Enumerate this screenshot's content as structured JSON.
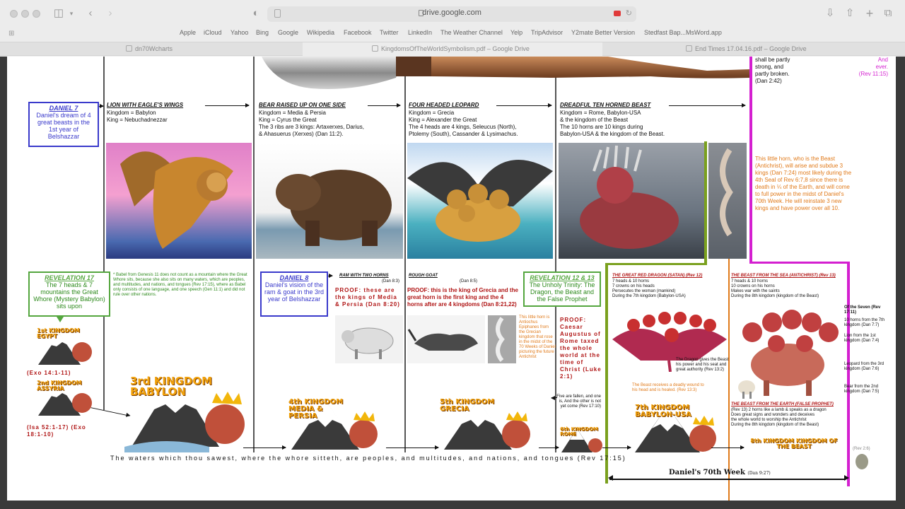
{
  "browser": {
    "url": "drive.google.com",
    "favorites": [
      "Apple",
      "iCloud",
      "Yahoo",
      "Bing",
      "Google",
      "Wikipedia",
      "Facebook",
      "Twitter",
      "LinkedIn",
      "The Weather Channel",
      "Yelp",
      "TripAdvisor",
      "Y2mate Better Version",
      "Stedfast Bap...MsWord.app"
    ],
    "tabs": [
      "dn70Wcharts",
      "KingdomsOfTheWorldSymbolism.pdf – Google Drive",
      "End Times 17.04.16.pdf – Google Drive"
    ]
  },
  "doc": {
    "daniel7": {
      "title": "DANIEL 7",
      "text": "Daniel's dream of 4 great beasts in the 1st year of Belshazzar"
    },
    "columns": [
      {
        "heading": "LION WITH EAGLE'S WINGS",
        "lines": [
          "Kingdom = Babylon",
          "King = Nebuchadnezzar"
        ]
      },
      {
        "heading": "BEAR RAISED UP ON ONE SIDE",
        "lines": [
          "Kingdom = Media & Persia",
          "King = Cyrus the Great",
          "The 3 ribs are 3 kings: Artaxerxes, Darius,",
          "& Ahasuerus (Xerxes) (Dan 11:2)."
        ]
      },
      {
        "heading": "FOUR HEADED LEOPARD",
        "lines": [
          "Kingdom = Grecia",
          "King = Alexander the Great",
          "The 4 heads are 4 kings, Seleucus (North),",
          "Ptolemy (South), Cassander & Lysimachus."
        ]
      },
      {
        "heading": "DREADFUL TEN HORNED BEAST",
        "lines": [
          "Kingdom = Rome, Babylon-USA",
          "& the kingdom of the Beast",
          "The 10 horns are 10 kings during",
          "Babylon-USA & the kingdom of the Beast."
        ]
      }
    ],
    "top_right_text": [
      "shall be partly",
      "strong, and",
      "partly broken.",
      "(Dan 2:42)"
    ],
    "magenta_text": [
      "And",
      "ever.",
      "(Rev 11:15)"
    ],
    "little_horn_text": "This little horn, who is the Beast (Antichrist), will arise and subdue 3 kings (Dan 7:24) most likely during the 4th Seal of Rev 6:7,8 since there is death in ¼ of the Earth, and will come to full power in the midst of Daniel's 70th Week. He will reinstate 3 new kings and have power over all 10.",
    "rev17": {
      "title": "REVELATION 17",
      "text": "The 7 heads & 7 mountains the Great Whore (Mystery Babylon) sits upon"
    },
    "rev17_note": "* Babel from Genesis 11 does not count as a mountain where the Great Whore sits, because she also sits on many waters, which are peoples, and multitudes, and nations, and tongues (Rev 17:15), where as Babel only consists of one language, and one speech (Gen 11:1) and did not rule over other nations.",
    "daniel8": {
      "title": "DANIEL 8",
      "text": "Daniel's vision of the ram & goat in the 3rd year of Belshazzar"
    },
    "ram_heading": "RAM WITH TWO HORNS",
    "ram_ref": "(Dan 8:3)",
    "ram_proof": "PROOF: these are the kings of Media & Persia (Dan 8:20)",
    "goat_heading": "ROUGH GOAT",
    "goat_ref": "(Dan 8:5)",
    "goat_proof": "PROOF: this is the king of Grecia and the great horn is the first king and the 4 horns after are 4 kingdoms (Dan 8:21,22)",
    "rev12": {
      "title": "REVELATION 12 & 13",
      "text": "The Unholy Trinity: The Dragon, the Beast and the False Prophet"
    },
    "dragon_heading": "THE GREAT RED DRAGON (SATAN)",
    "dragon_ref": "(Rev 12)",
    "dragon_lines": [
      "7 heads & 10 horns",
      "7 crowns on his heads",
      "Persecutes the woman (mankind)",
      "During the 7th kingdom (Babylon-USA)"
    ],
    "sea_beast_heading": "THE BEAST FROM THE SEA (ANTICHRIST)",
    "sea_beast_ref": "(Rev 13)",
    "sea_beast_lines": [
      "7 heads & 10 horns",
      "10 crowns on his horns",
      "Makes war with the saints",
      "During the 8th kingdom (kingdom of the Beast)"
    ],
    "earth_beast_heading": "THE BEAST FROM THE EARTH (FALSE PROPHET)",
    "earth_beast_lines": [
      "(Rev 13) 2 horns like a lamb & speaks as a dragon",
      "Does great signs and wonders and deceives",
      "the whole world to worship the Antichrist",
      "During the 8th kingdom (kingdom of the Beast)"
    ],
    "dragon_gives": "The Dragon gives the Beast his power and his seat and great authority (Rev 13:2)",
    "beast_wound": "The Beast receives a deadly wound to his head and is healed. (Rev 13:3)",
    "seven_list_title": "Of the Seven (Rev 17:11)",
    "seven_list": [
      "10 horns from the 7th kingdom (Dan 7:7)",
      "Lion from the 1st kingdom (Dan 7:4)",
      "Leopard from the 3rd kingdom (Dan 7:6)",
      "Bear from the 2nd kingdom (Dan 7:5)"
    ],
    "five_fallen": "Five are fallen, and one is, And the other is not yet come (Rev 17:10)",
    "proof_augustus": "PROOF: Caesar Augustus of Rome taxed the whole world at the time of Christ (Luke 2:1)",
    "little_horn_note": "This little horn is Antiochus Epiphanes from the Grecian kingdom that rose in the midst of the 70 Weeks of Daniel picturing the future Antichrist",
    "kingdoms": [
      {
        "label": "1st KINGDOM EGYPT",
        "ref": "(Exo 14:1-11)"
      },
      {
        "label": "2nd KINGDOM ASSYRIA",
        "ref": "(Isa 52:1-17) (Exo 18:1-10)"
      },
      {
        "label": "3rd KINGDOM BABYLON"
      },
      {
        "label": "4th KINGDOM MEDIA & PERSIA"
      },
      {
        "label": "5th KINGDOM GRECIA"
      },
      {
        "label": "6th KINGDOM ROME"
      },
      {
        "label": "7th KINGDOM BABYLON-USA"
      },
      {
        "label": "8th KINGDOM KINGDOM OF THE BEAST"
      }
    ],
    "bottom_banner": "The waters which thou sawest, where the whore sitteth, are peoples, and multitudes, and nations, and tongues (Rev 17:15)",
    "daniels_week": "Daniel's 70th Week",
    "daniels_week_ref": "(Dan 9:27)",
    "rev_ref_small": "(Rev 2:6)"
  },
  "colors": {
    "blue": "#3a3acb",
    "green": "#54a63e",
    "magenta": "#d41fd0",
    "orange": "#e07a1a",
    "olive": "#7aa01e"
  }
}
